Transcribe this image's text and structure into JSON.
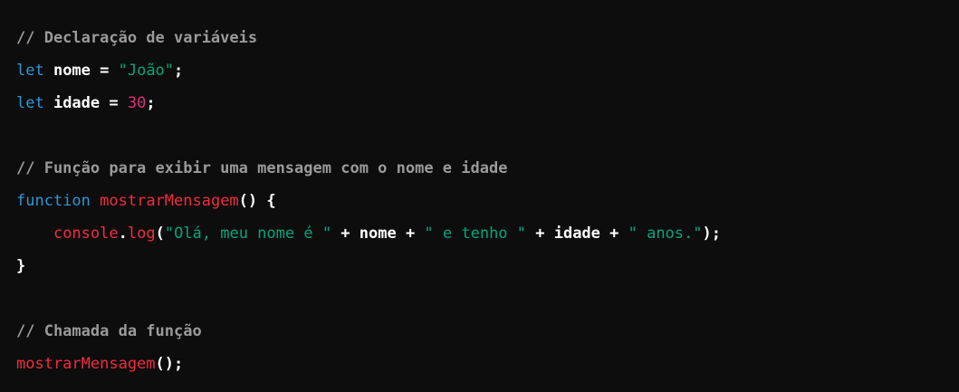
{
  "code_lines": [
    {
      "tokens": [
        {
          "type": "comment",
          "text": "// Declaração de variáveis"
        }
      ]
    },
    {
      "tokens": [
        {
          "type": "keyword",
          "text": "let"
        },
        {
          "type": "plain",
          "text": " nome = "
        },
        {
          "type": "string",
          "text": "\"João\""
        },
        {
          "type": "punct",
          "text": ";"
        }
      ]
    },
    {
      "tokens": [
        {
          "type": "keyword",
          "text": "let"
        },
        {
          "type": "plain",
          "text": " idade = "
        },
        {
          "type": "number",
          "text": "30"
        },
        {
          "type": "punct",
          "text": ";"
        }
      ]
    },
    {
      "tokens": []
    },
    {
      "tokens": [
        {
          "type": "comment",
          "text": "// Função para exibir uma mensagem com o nome e idade"
        }
      ]
    },
    {
      "tokens": [
        {
          "type": "keyword",
          "text": "function"
        },
        {
          "type": "plain",
          "text": " "
        },
        {
          "type": "func",
          "text": "mostrarMensagem"
        },
        {
          "type": "punct",
          "text": "() {"
        }
      ]
    },
    {
      "tokens": [
        {
          "type": "plain",
          "text": "    "
        },
        {
          "type": "func",
          "text": "console"
        },
        {
          "type": "punct",
          "text": "."
        },
        {
          "type": "func",
          "text": "log"
        },
        {
          "type": "punct",
          "text": "("
        },
        {
          "type": "string",
          "text": "\"Olá, meu nome é \""
        },
        {
          "type": "plain",
          "text": " + nome + "
        },
        {
          "type": "string",
          "text": "\" e tenho \""
        },
        {
          "type": "plain",
          "text": " + idade + "
        },
        {
          "type": "string",
          "text": "\" anos.\""
        },
        {
          "type": "punct",
          "text": ");"
        }
      ]
    },
    {
      "tokens": [
        {
          "type": "punct",
          "text": "}"
        }
      ]
    },
    {
      "tokens": []
    },
    {
      "tokens": [
        {
          "type": "comment",
          "text": "// Chamada da função"
        }
      ]
    },
    {
      "tokens": [
        {
          "type": "func",
          "text": "mostrarMensagem"
        },
        {
          "type": "punct",
          "text": "();"
        }
      ]
    }
  ],
  "colors": {
    "background": "#0d0d0d",
    "comment": "#9a9a9a",
    "keyword": "#2e95d3",
    "string": "#00a67d",
    "number": "#df3079",
    "function": "#f22c3d",
    "plain": "#ffffff"
  }
}
